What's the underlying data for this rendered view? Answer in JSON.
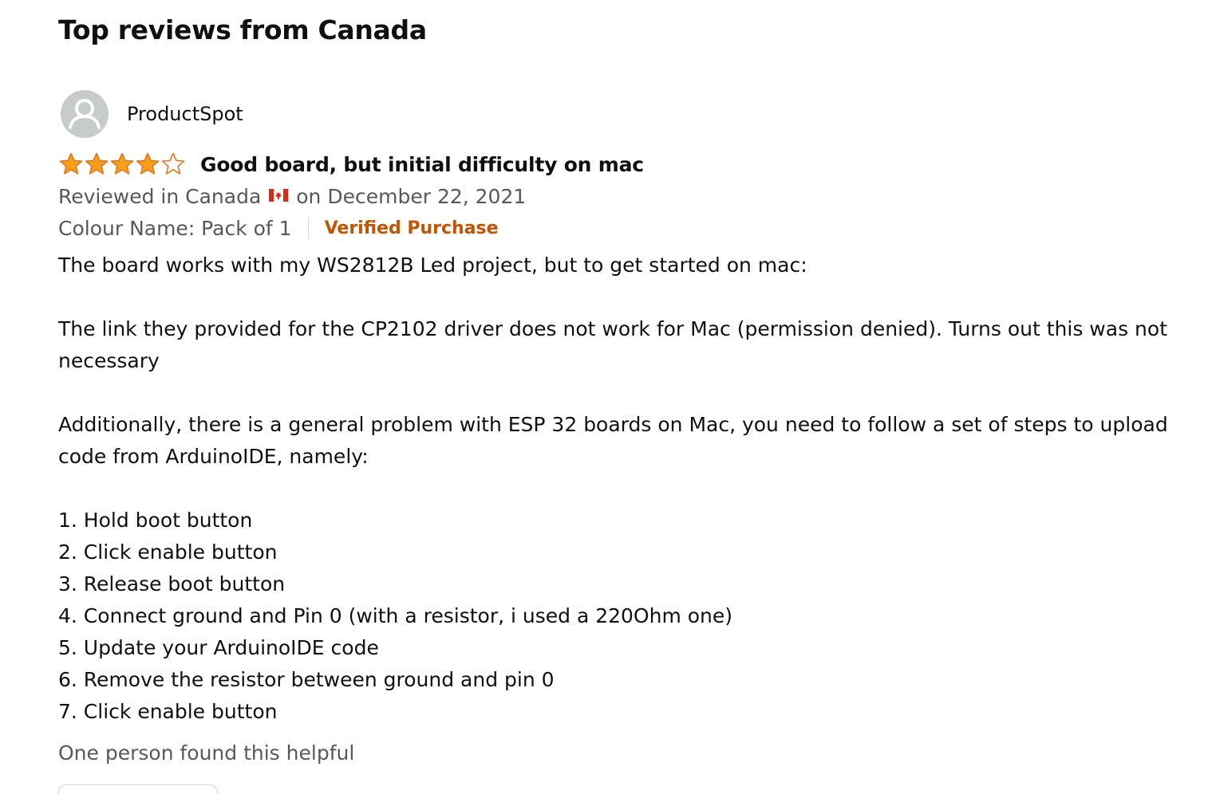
{
  "section": {
    "heading": "Top reviews from Canada"
  },
  "review": {
    "profile_name": "ProductSpot",
    "rating": 4,
    "rating_max": 5,
    "title": "Good board, but initial difficulty on mac",
    "reviewed_prefix": "Reviewed in Canada",
    "reviewed_suffix": "on December 22, 2021",
    "variant": "Colour Name: Pack of 1",
    "verified_label": "Verified Purchase",
    "body": {
      "p1": "The board works with my WS2812B Led project, but to get started on mac:",
      "p2": "The link they provided for the CP2102 driver does not work for Mac (permission denied). Turns out this was not necessary",
      "p3": "Additionally, there is a general problem with ESP 32 boards on Mac, you need to follow a set of steps to upload code from ArduinoIDE, namely:",
      "steps": [
        "1. Hold boot button",
        "2. Click enable button",
        "3. Release boot button",
        "4. Connect ground and Pin 0 (with a resistor, i used a 220Ohm one)",
        "5. Update your ArduinoIDE code",
        "6. Remove the resistor between ground and pin 0",
        "7. Click enable button"
      ]
    },
    "helpful_text": "One person found this helpful"
  },
  "colors": {
    "star": "#f79e1b",
    "star_stroke": "#de7921",
    "verified": "#c45500",
    "meta_text": "#565959",
    "avatar_bg": "#c7cbcc"
  },
  "icons": {
    "avatar": "user-silhouette-icon",
    "star": "star-icon",
    "flag": "canada-flag-icon"
  }
}
